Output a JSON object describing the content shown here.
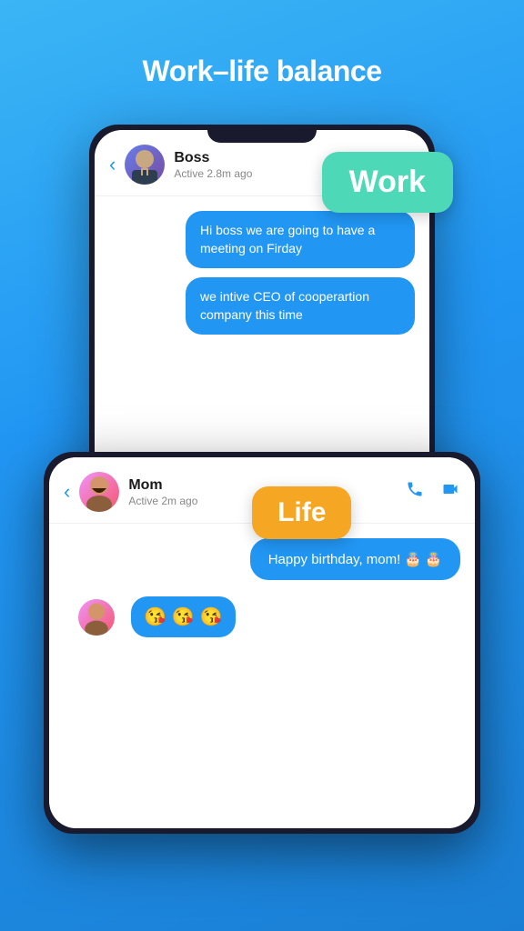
{
  "page": {
    "title": "Work–life balance",
    "background_gradient_start": "#3bb5f5",
    "background_gradient_end": "#1a7fd4"
  },
  "work_label": {
    "text": "Work",
    "color": "#4dd9b8"
  },
  "life_label": {
    "text": "Life",
    "color": "#f5a623"
  },
  "work_chat": {
    "contact_name": "Boss",
    "contact_status": "Active 2.8m ago",
    "messages": [
      {
        "text": "Hi boss we are going to have a meeting on Firday",
        "type": "sent"
      },
      {
        "text": "we intive CEO of cooperartion company this time",
        "type": "sent"
      }
    ]
  },
  "life_chat": {
    "contact_name": "Mom",
    "contact_status": "Active 2m ago",
    "messages": [
      {
        "text": "Happy birthday, mom! 🎂 🎂",
        "type": "sent"
      }
    ],
    "emoji_response": "😘 😘 😘"
  },
  "icons": {
    "back": "‹",
    "phone": "📞",
    "video": "📹"
  }
}
